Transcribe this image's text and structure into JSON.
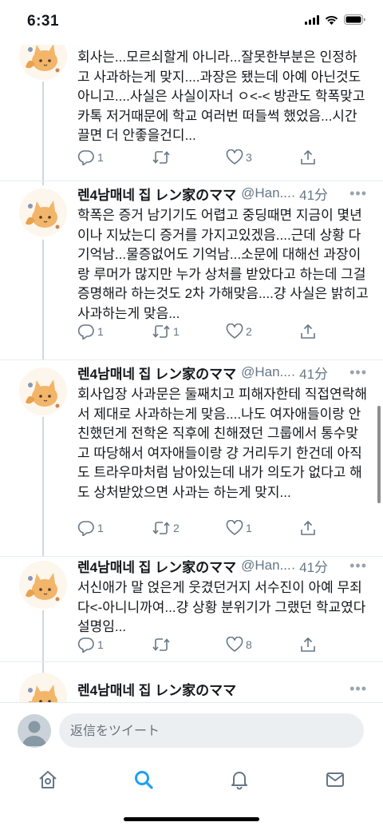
{
  "status_bar": {
    "time": "6:31",
    "signal_icon": "signal-bars-icon",
    "wifi_icon": "wifi-icon",
    "battery_icon": "battery-icon"
  },
  "tweets": [
    {
      "name": "",
      "handle": "",
      "time": "",
      "text": "회사는...모르쇠할게 아니라...잘못한부분은 인정하고 사과하는게 맞지....과장은 됐는데 아예 아닌것도 아니고....사실은 사실이자너 ㅇ<-< 방관도 학폭맞고 카톡 저거때문에 학교 여러번 떠들썩 했었음...시간 끌면 더 안좋을건디...",
      "replies": "1",
      "retweets": "",
      "likes": "3"
    },
    {
      "name": "렌4남매네 집 レン家のママ",
      "handle": "@Han...",
      "time": "· 41分",
      "text": "학폭은 증거 남기기도 어렵고 중딩때면 지금이 몇년이나 지났는디 증거를 가지고있겠음....근데 상황 다 기억남...물증없어도 기억남...소문에 대해선 과장이랑 루머가 많지만 누가 상처를 받았다고 하는데 그걸 증명해라 하는것도 2차 가해맞음....걍 사실은 밝히고 사과하는게 맞음...",
      "replies": "1",
      "retweets": "1",
      "likes": "2"
    },
    {
      "name": "렌4남매네 집 レン家のママ",
      "handle": "@Han...",
      "time": "· 41分",
      "text": "회사입장 사과문은 둘째치고 피해자한테 직접연락해서 제대로 사과하는게 맞음....나도 여자애들이랑 안친했던게 전학온 직후에 친해졌던 그룹에서 통수맞고 따당해서 여자애들이랑 걍 거리두기 한건데 아직도 트라우마처럼 남아있는데 내가 의도가 없다고 해도 상처받았으면 사과는 하는게 맞지...",
      "replies": "1",
      "retweets": "2",
      "likes": "1"
    },
    {
      "name": "렌4남매네 집 レン家のママ",
      "handle": "@Han...",
      "time": "· 41分",
      "text": "서신애가 말 얹은게 웃겼던거지 서수진이 아예 무죄다<-아니니까여...걍 상황 분위기가 그랬던 학교였다 설명임...",
      "replies": "1",
      "retweets": "",
      "likes": "8"
    },
    {
      "name": "렌4남매네 집 レン家のママ",
      "handle": "",
      "time": "",
      "text": "",
      "replies": "",
      "retweets": "",
      "likes": ""
    }
  ],
  "reply_bar": {
    "placeholder": "返信をツイート",
    "avatar_icon": "default-avatar-icon"
  },
  "tab_bar": {
    "items": [
      "home-icon",
      "search-icon",
      "notifications-icon",
      "messages-icon"
    ],
    "active": "search-icon"
  },
  "colors": {
    "accent": "#1da1f2",
    "text": "#14171a",
    "secondary": "#657786",
    "thread_line": "#cfd9de",
    "divider": "#e6ecf0"
  }
}
